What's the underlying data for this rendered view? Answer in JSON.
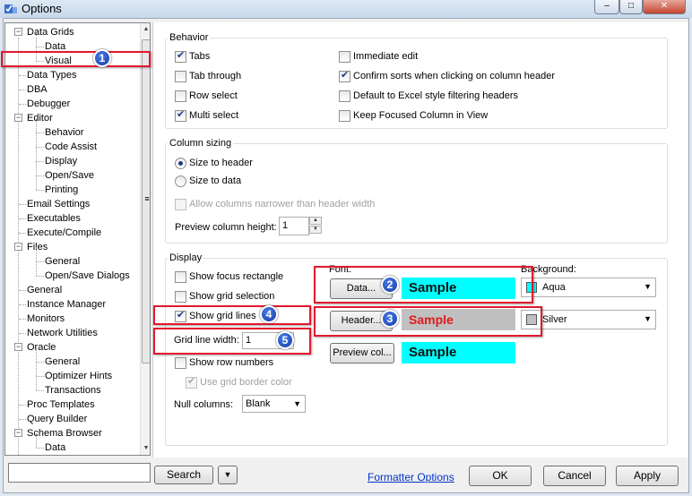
{
  "window": {
    "title": "Options",
    "minimize": "–",
    "maximize": "□",
    "close": "✕"
  },
  "tree": {
    "items": [
      {
        "label": "Data Grids",
        "level": 0,
        "expander": "−"
      },
      {
        "label": "Data",
        "level": 1
      },
      {
        "label": "Visual",
        "level": 1
      },
      {
        "label": "Data Types",
        "level": 0
      },
      {
        "label": "DBA",
        "level": 0
      },
      {
        "label": "Debugger",
        "level": 0
      },
      {
        "label": "Editor",
        "level": 0,
        "expander": "−"
      },
      {
        "label": "Behavior",
        "level": 1
      },
      {
        "label": "Code Assist",
        "level": 1
      },
      {
        "label": "Display",
        "level": 1
      },
      {
        "label": "Open/Save",
        "level": 1
      },
      {
        "label": "Printing",
        "level": 1
      },
      {
        "label": "Email Settings",
        "level": 0
      },
      {
        "label": "Executables",
        "level": 0
      },
      {
        "label": "Execute/Compile",
        "level": 0
      },
      {
        "label": "Files",
        "level": 0,
        "expander": "−"
      },
      {
        "label": "General",
        "level": 1
      },
      {
        "label": "Open/Save Dialogs",
        "level": 1
      },
      {
        "label": "General",
        "level": 0
      },
      {
        "label": "Instance Manager",
        "level": 0
      },
      {
        "label": "Monitors",
        "level": 0
      },
      {
        "label": "Network Utilities",
        "level": 0
      },
      {
        "label": "Oracle",
        "level": 0,
        "expander": "−"
      },
      {
        "label": "General",
        "level": 1
      },
      {
        "label": "Optimizer Hints",
        "level": 1
      },
      {
        "label": "Transactions",
        "level": 1
      },
      {
        "label": "Proc Templates",
        "level": 0
      },
      {
        "label": "Query Builder",
        "level": 0
      },
      {
        "label": "Schema Browser",
        "level": 0,
        "expander": "−"
      },
      {
        "label": "Data",
        "level": 1
      }
    ],
    "scroll_up": "▲",
    "scroll_down": "▼",
    "thumb_grip": "≡"
  },
  "behavior": {
    "title": "Behavior",
    "tabs": "Tabs",
    "tab_through": "Tab through",
    "row_select": "Row select",
    "multi_select": "Multi select",
    "immediate_edit": "Immediate edit",
    "confirm_sorts": "Confirm sorts when clicking on column header",
    "default_excel": "Default to Excel style filtering headers",
    "keep_focused": "Keep Focused Column in View"
  },
  "column_sizing": {
    "title": "Column sizing",
    "size_to_header": "Size to header",
    "size_to_data": "Size to data",
    "allow_narrower": "Allow columns narrower than header width",
    "preview_height_label": "Preview column height:",
    "preview_height_value": "1"
  },
  "display": {
    "title": "Display",
    "show_focus": "Show focus rectangle",
    "show_grid_selection": "Show grid selection",
    "show_grid_lines": "Show grid lines",
    "grid_line_width_label": "Grid line width:",
    "grid_line_width_value": "1",
    "show_row_numbers": "Show row numbers",
    "use_grid_border": "Use grid border color",
    "null_columns_label": "Null columns:",
    "null_columns_value": "Blank",
    "font_label": "Font:",
    "background_label": "Background:",
    "data_btn": "Data...",
    "header_btn": "Header...",
    "preview_btn": "Preview col...",
    "sample": "Sample",
    "data_bg": "Aqua",
    "header_bg": "Silver",
    "colors": {
      "aqua": "#00ffff",
      "silver": "#c0c0c0",
      "header_text": "#e01b1b"
    }
  },
  "bottom": {
    "search_value": "",
    "search_btn": "Search",
    "search_drop": "▼",
    "formatter_link": "Formatter Options",
    "ok": "OK",
    "cancel": "Cancel",
    "apply": "Apply"
  },
  "markers": [
    "1",
    "2",
    "3",
    "4",
    "5"
  ]
}
